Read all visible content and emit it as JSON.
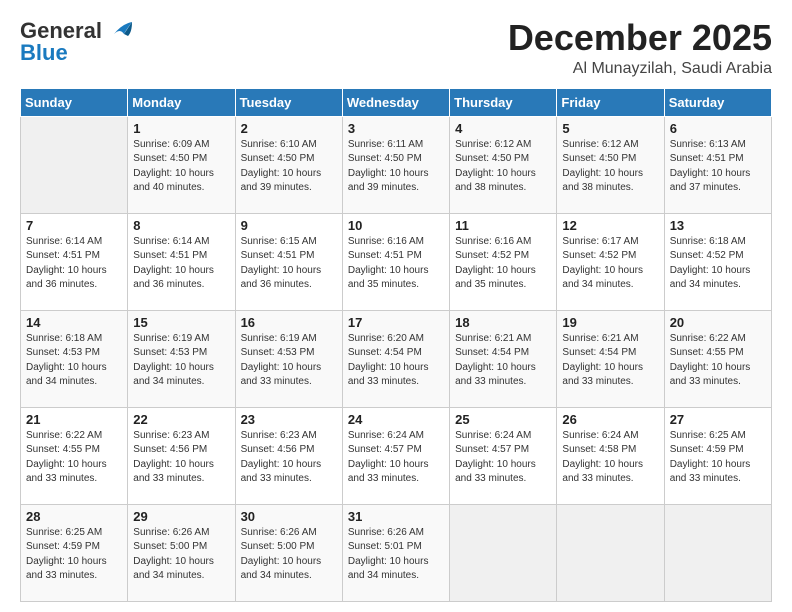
{
  "logo": {
    "general": "General",
    "blue": "Blue"
  },
  "header": {
    "month": "December 2025",
    "location": "Al Munayzilah, Saudi Arabia"
  },
  "weekdays": [
    "Sunday",
    "Monday",
    "Tuesday",
    "Wednesday",
    "Thursday",
    "Friday",
    "Saturday"
  ],
  "weeks": [
    [
      {
        "day": "",
        "info": ""
      },
      {
        "day": "1",
        "info": "Sunrise: 6:09 AM\nSunset: 4:50 PM\nDaylight: 10 hours\nand 40 minutes."
      },
      {
        "day": "2",
        "info": "Sunrise: 6:10 AM\nSunset: 4:50 PM\nDaylight: 10 hours\nand 39 minutes."
      },
      {
        "day": "3",
        "info": "Sunrise: 6:11 AM\nSunset: 4:50 PM\nDaylight: 10 hours\nand 39 minutes."
      },
      {
        "day": "4",
        "info": "Sunrise: 6:12 AM\nSunset: 4:50 PM\nDaylight: 10 hours\nand 38 minutes."
      },
      {
        "day": "5",
        "info": "Sunrise: 6:12 AM\nSunset: 4:50 PM\nDaylight: 10 hours\nand 38 minutes."
      },
      {
        "day": "6",
        "info": "Sunrise: 6:13 AM\nSunset: 4:51 PM\nDaylight: 10 hours\nand 37 minutes."
      }
    ],
    [
      {
        "day": "7",
        "info": "Sunrise: 6:14 AM\nSunset: 4:51 PM\nDaylight: 10 hours\nand 36 minutes."
      },
      {
        "day": "8",
        "info": "Sunrise: 6:14 AM\nSunset: 4:51 PM\nDaylight: 10 hours\nand 36 minutes."
      },
      {
        "day": "9",
        "info": "Sunrise: 6:15 AM\nSunset: 4:51 PM\nDaylight: 10 hours\nand 36 minutes."
      },
      {
        "day": "10",
        "info": "Sunrise: 6:16 AM\nSunset: 4:51 PM\nDaylight: 10 hours\nand 35 minutes."
      },
      {
        "day": "11",
        "info": "Sunrise: 6:16 AM\nSunset: 4:52 PM\nDaylight: 10 hours\nand 35 minutes."
      },
      {
        "day": "12",
        "info": "Sunrise: 6:17 AM\nSunset: 4:52 PM\nDaylight: 10 hours\nand 34 minutes."
      },
      {
        "day": "13",
        "info": "Sunrise: 6:18 AM\nSunset: 4:52 PM\nDaylight: 10 hours\nand 34 minutes."
      }
    ],
    [
      {
        "day": "14",
        "info": "Sunrise: 6:18 AM\nSunset: 4:53 PM\nDaylight: 10 hours\nand 34 minutes."
      },
      {
        "day": "15",
        "info": "Sunrise: 6:19 AM\nSunset: 4:53 PM\nDaylight: 10 hours\nand 34 minutes."
      },
      {
        "day": "16",
        "info": "Sunrise: 6:19 AM\nSunset: 4:53 PM\nDaylight: 10 hours\nand 33 minutes."
      },
      {
        "day": "17",
        "info": "Sunrise: 6:20 AM\nSunset: 4:54 PM\nDaylight: 10 hours\nand 33 minutes."
      },
      {
        "day": "18",
        "info": "Sunrise: 6:21 AM\nSunset: 4:54 PM\nDaylight: 10 hours\nand 33 minutes."
      },
      {
        "day": "19",
        "info": "Sunrise: 6:21 AM\nSunset: 4:54 PM\nDaylight: 10 hours\nand 33 minutes."
      },
      {
        "day": "20",
        "info": "Sunrise: 6:22 AM\nSunset: 4:55 PM\nDaylight: 10 hours\nand 33 minutes."
      }
    ],
    [
      {
        "day": "21",
        "info": "Sunrise: 6:22 AM\nSunset: 4:55 PM\nDaylight: 10 hours\nand 33 minutes."
      },
      {
        "day": "22",
        "info": "Sunrise: 6:23 AM\nSunset: 4:56 PM\nDaylight: 10 hours\nand 33 minutes."
      },
      {
        "day": "23",
        "info": "Sunrise: 6:23 AM\nSunset: 4:56 PM\nDaylight: 10 hours\nand 33 minutes."
      },
      {
        "day": "24",
        "info": "Sunrise: 6:24 AM\nSunset: 4:57 PM\nDaylight: 10 hours\nand 33 minutes."
      },
      {
        "day": "25",
        "info": "Sunrise: 6:24 AM\nSunset: 4:57 PM\nDaylight: 10 hours\nand 33 minutes."
      },
      {
        "day": "26",
        "info": "Sunrise: 6:24 AM\nSunset: 4:58 PM\nDaylight: 10 hours\nand 33 minutes."
      },
      {
        "day": "27",
        "info": "Sunrise: 6:25 AM\nSunset: 4:59 PM\nDaylight: 10 hours\nand 33 minutes."
      }
    ],
    [
      {
        "day": "28",
        "info": "Sunrise: 6:25 AM\nSunset: 4:59 PM\nDaylight: 10 hours\nand 33 minutes."
      },
      {
        "day": "29",
        "info": "Sunrise: 6:26 AM\nSunset: 5:00 PM\nDaylight: 10 hours\nand 34 minutes."
      },
      {
        "day": "30",
        "info": "Sunrise: 6:26 AM\nSunset: 5:00 PM\nDaylight: 10 hours\nand 34 minutes."
      },
      {
        "day": "31",
        "info": "Sunrise: 6:26 AM\nSunset: 5:01 PM\nDaylight: 10 hours\nand 34 minutes."
      },
      {
        "day": "",
        "info": ""
      },
      {
        "day": "",
        "info": ""
      },
      {
        "day": "",
        "info": ""
      }
    ]
  ]
}
